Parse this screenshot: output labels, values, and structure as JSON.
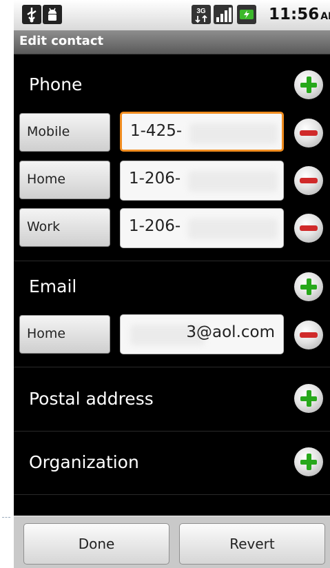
{
  "status_bar": {
    "time": "11:56",
    "ampm": "AM",
    "icons": [
      "usb-icon",
      "android-debug-icon",
      "3g-data-icon",
      "signal-icon",
      "battery-charging-icon"
    ]
  },
  "title": "Edit contact",
  "phone": {
    "label": "Phone",
    "entries": [
      {
        "type": "Mobile",
        "value": "1-425-"
      },
      {
        "type": "Home",
        "value": "1-206-"
      },
      {
        "type": "Work",
        "value": "1-206-"
      }
    ]
  },
  "email": {
    "label": "Email",
    "entries": [
      {
        "type": "Home",
        "value": "3@aol.com"
      }
    ]
  },
  "postal": {
    "label": "Postal address"
  },
  "organization": {
    "label": "Organization"
  },
  "buttons": {
    "done": "Done",
    "revert": "Revert"
  },
  "colors": {
    "focus": "#f08c1f",
    "add": "#27a81b",
    "remove": "#d02a2a"
  }
}
